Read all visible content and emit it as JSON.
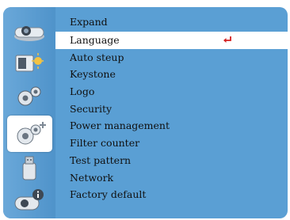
{
  "menu": {
    "section_label": "Expand",
    "items": [
      {
        "label": "Language"
      },
      {
        "label": "Auto steup"
      },
      {
        "label": "Keystone"
      },
      {
        "label": "Logo"
      },
      {
        "label": "Security"
      },
      {
        "label": "Power management"
      },
      {
        "label": "Filter counter"
      },
      {
        "label": "Test pattern"
      },
      {
        "label": "Network"
      },
      {
        "label": "Factory default"
      }
    ],
    "highlighted_index": 0,
    "enter_icon": "return-arrow-icon"
  },
  "sidebar": {
    "icons": [
      {
        "name": "projector-image-icon"
      },
      {
        "name": "display-setting-icon"
      },
      {
        "name": "setting-gear-icon"
      },
      {
        "name": "expand-gear-icon",
        "selected": true
      },
      {
        "name": "usb-memory-icon"
      },
      {
        "name": "info-projector-icon"
      }
    ]
  },
  "colors": {
    "menu_background": "#5a9fd4",
    "highlight": "#ffffff",
    "enter_arrow": "#d42020"
  }
}
